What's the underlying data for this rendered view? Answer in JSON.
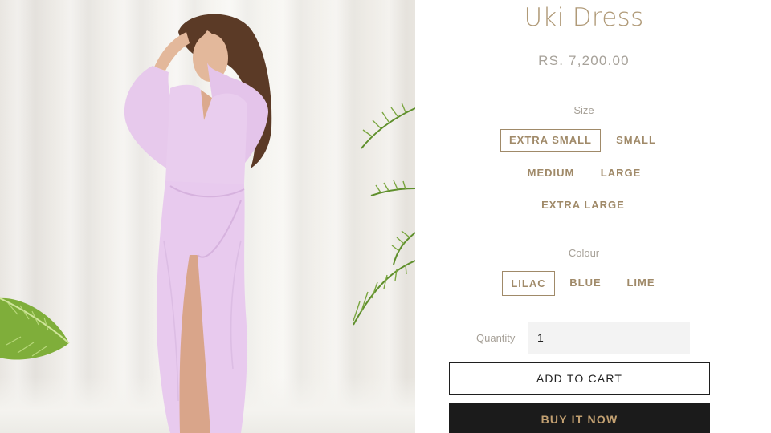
{
  "product": {
    "title": "Uki Dress",
    "price": "RS. 7,200.00",
    "image_alt": "Model wearing the lilac Uki wrap dress"
  },
  "size": {
    "label": "Size",
    "options": [
      "EXTRA SMALL",
      "SMALL",
      "MEDIUM",
      "LARGE",
      "EXTRA LARGE"
    ],
    "selected": "EXTRA SMALL"
  },
  "colour": {
    "label": "Colour",
    "options": [
      "LILAC",
      "BLUE",
      "LIME"
    ],
    "selected": "LILAC"
  },
  "quantity": {
    "label": "Quantity",
    "value": "1"
  },
  "actions": {
    "add_to_cart": "ADD TO CART",
    "buy_now": "BUY IT NOW"
  },
  "colors": {
    "accent": "#b09a78",
    "dress": "#e7c9ec",
    "button_dark": "#1b1b1b",
    "buy_now_text": "#c2a071"
  }
}
